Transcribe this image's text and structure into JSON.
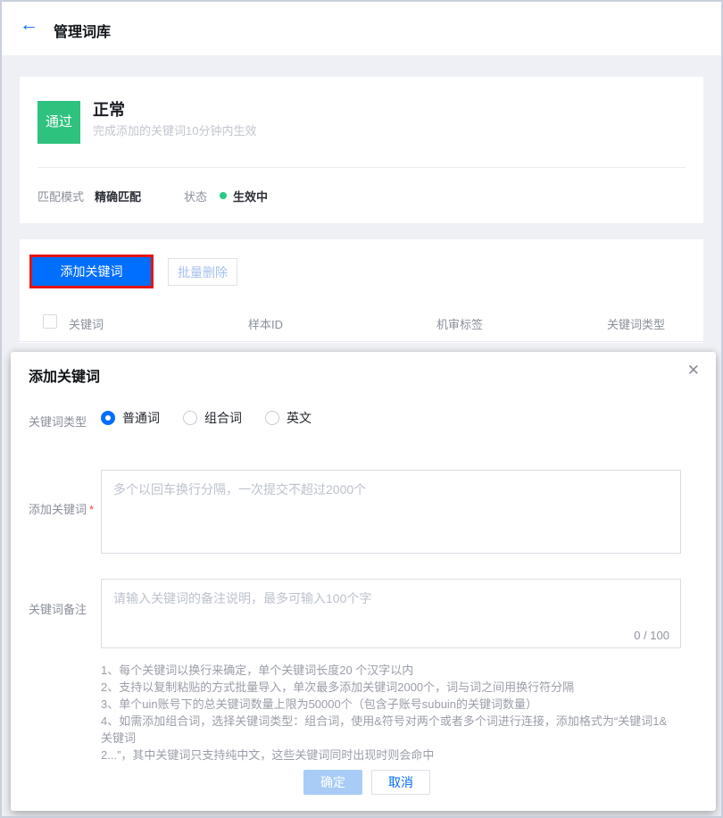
{
  "icons": {
    "back": "←",
    "close": "✕"
  },
  "colors": {
    "primary_blue": "#006eff",
    "success_green": "#2fc27e",
    "status_dot_green": "#29cc85",
    "annotation_red": "#e61414",
    "disabled_confirm_blue": "#a9ccf6",
    "page_background": "#eef0f5"
  },
  "page": {
    "header": {
      "title": "管理词库"
    },
    "status_card": {
      "badge": "通过",
      "title": "正常",
      "subtitle": "完成添加的关键词10分钟内生效",
      "fields": [
        {
          "label": "匹配模式",
          "value": "精确匹配"
        },
        {
          "label": "状态",
          "value": "生效中"
        }
      ]
    },
    "table_card": {
      "add_button": "添加关键词",
      "batch_delete_button": "批量删除",
      "columns": [
        "关键词",
        "样本ID",
        "机审标签",
        "关键词类型"
      ]
    }
  },
  "modal": {
    "title": "添加关键词",
    "type_field": {
      "label": "关键词类型",
      "options": [
        {
          "label": "普通词",
          "selected": true
        },
        {
          "label": "组合词",
          "selected": false
        },
        {
          "label": "英文",
          "selected": false
        }
      ]
    },
    "keywords_field": {
      "label": "添加关键词",
      "required": "*",
      "placeholder": "多个以回车换行分隔，一次提交不超过2000个",
      "value": ""
    },
    "remark_field": {
      "label": "关键词备注",
      "placeholder": "请输入关键词的备注说明，最多可输入100个字",
      "value": "",
      "counter": "0 / 100"
    },
    "notes": [
      "1、每个关键词以换行来确定，单个关键词长度20 个汉字以内",
      "2、支持以复制粘贴的方式批量导入，单次最多添加关键词2000个，词与词之间用换行符分隔",
      "3、单个uin账号下的总关键词数量上限为50000个（包含子账号subuin的关键词数量）",
      "4、如需添加组合词，选择关键词类型：组合词，使用&符号对两个或者多个词进行连接，添加格式为“关键词1&关键词",
      "2...”，其中关键词只支持纯中文，这些关键词同时出现时则会命中"
    ],
    "confirm_button": "确定",
    "cancel_button": "取消"
  }
}
